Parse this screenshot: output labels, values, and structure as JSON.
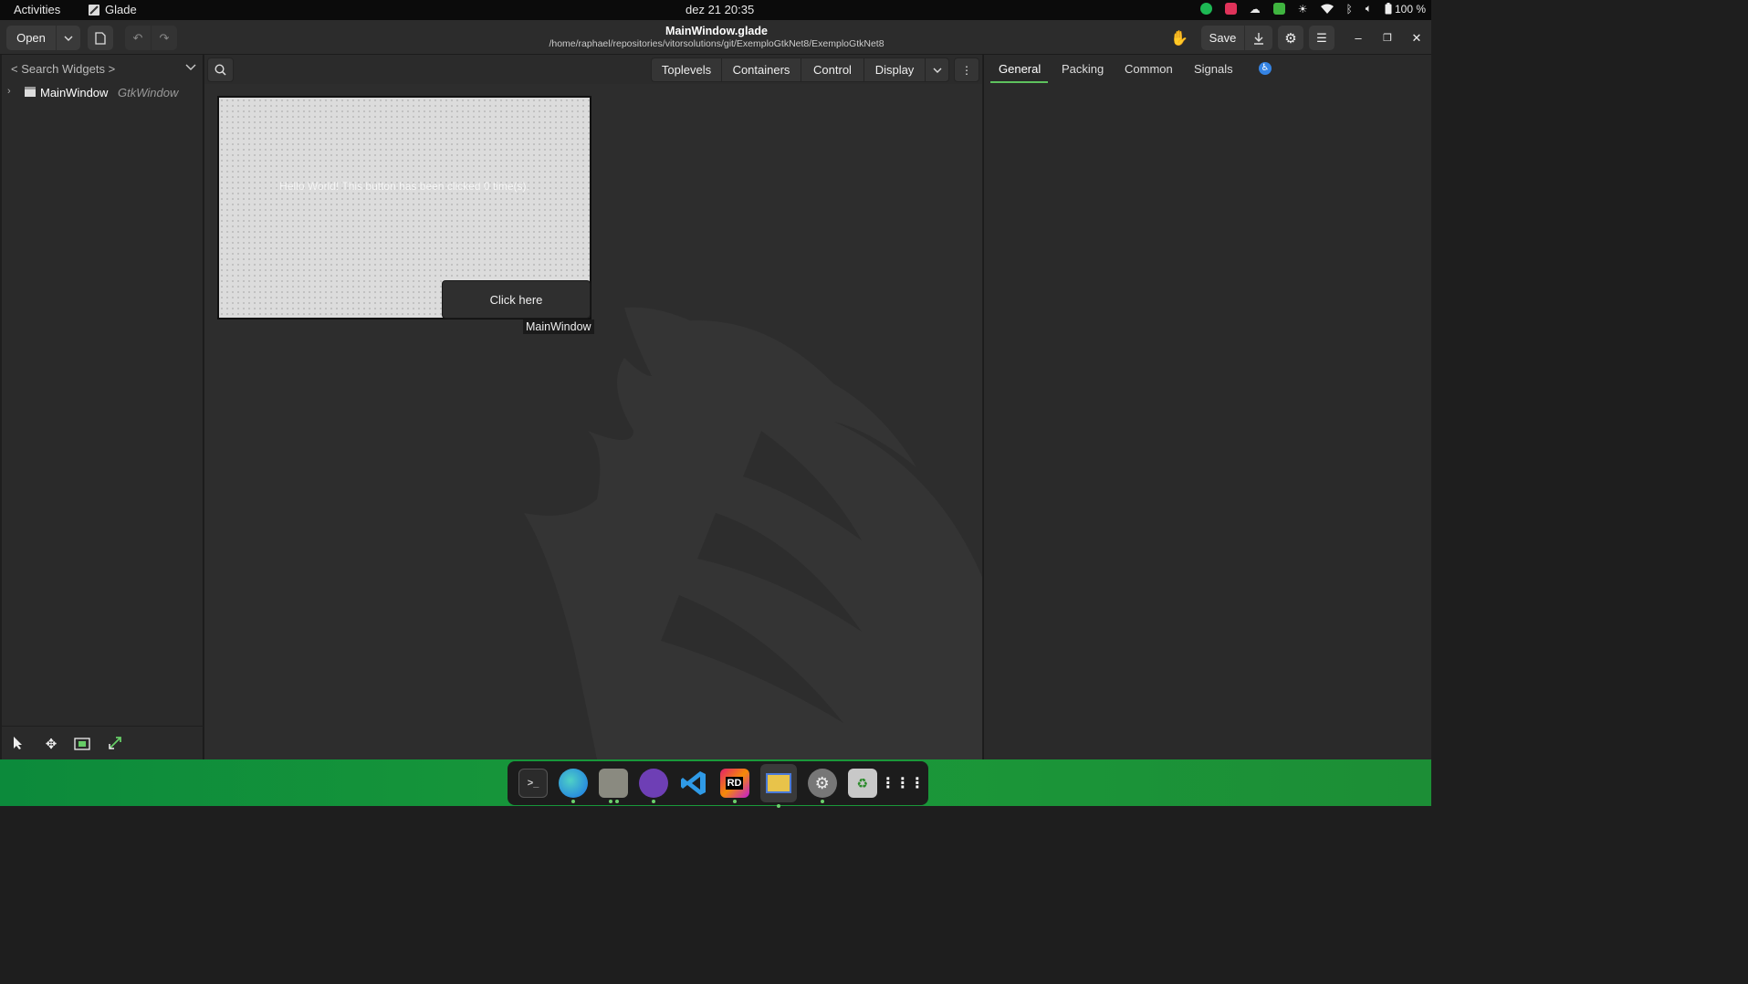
{
  "topbar": {
    "activities": "Activities",
    "app_name": "Glade",
    "clock": "dez 21  20:35",
    "battery": "100 %",
    "tray_icons": [
      "spotify-icon",
      "shield-app-icon",
      "cloud-icon",
      "check-app-icon",
      "brightness-icon",
      "wifi-icon",
      "bluetooth-icon",
      "volume-icon",
      "battery-icon"
    ]
  },
  "header": {
    "open_label": "Open",
    "title": "MainWindow.glade",
    "subtitle": "/home/raphael/repositories/vitorsolutions/git/ExemploGtkNet8/ExemploGtkNet8",
    "save_label": "Save"
  },
  "left_panel": {
    "search_placeholder": "< Search Widgets >",
    "tree": [
      {
        "name": "MainWindow",
        "type": "GtkWindow"
      }
    ]
  },
  "palette": {
    "groups": [
      "Toplevels",
      "Containers",
      "Control",
      "Display"
    ]
  },
  "canvas": {
    "hello_text": "Hello World! This button has been clicked 0 time(s).",
    "button_label": "Click here",
    "window_label": "MainWindow"
  },
  "right_panel": {
    "tabs": [
      "General",
      "Packing",
      "Common",
      "Signals"
    ],
    "active_tab": "General"
  },
  "dock": {
    "apps": [
      "terminal-icon",
      "edge-browser-icon",
      "files-icon",
      "github-desktop-icon",
      "vscode-icon",
      "rider-icon",
      "glade-icon",
      "settings-icon",
      "trash-icon",
      "app-grid-icon"
    ],
    "rider_badge": "RD"
  },
  "colors": {
    "accent_green": "#5ec25e",
    "taskbar_green": "#1a9a3a"
  }
}
